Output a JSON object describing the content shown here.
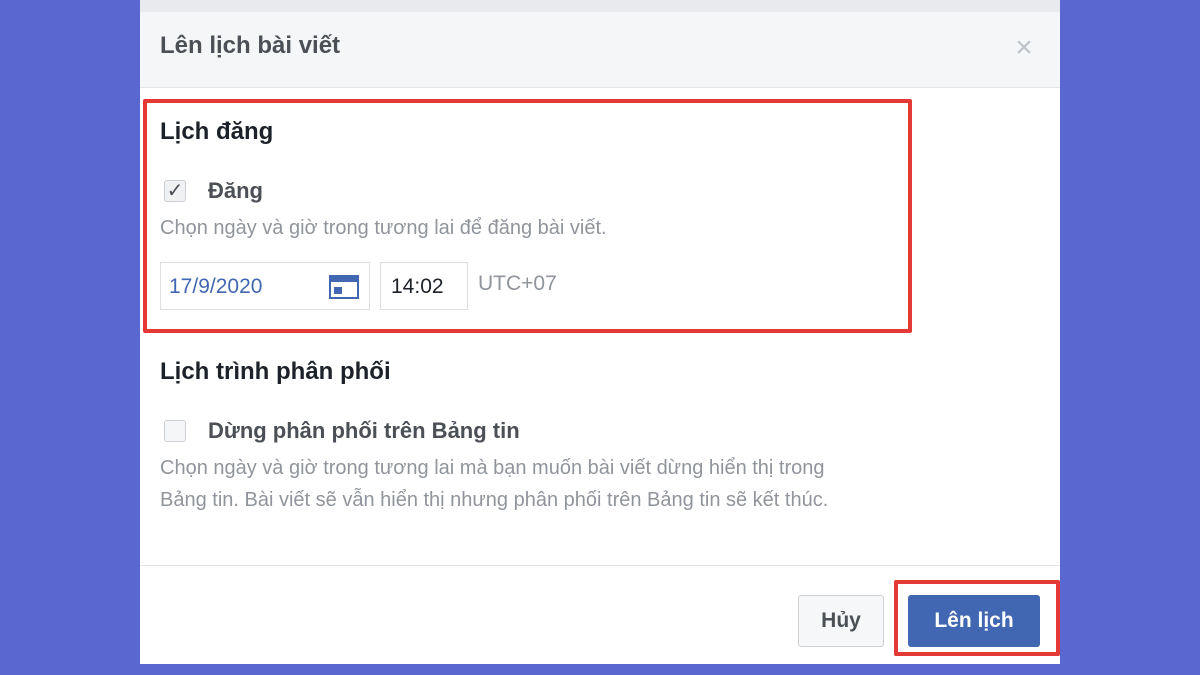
{
  "dialog": {
    "title": "Lên lịch bài viết",
    "close_icon": "close-icon"
  },
  "schedule_section": {
    "title": "Lịch đăng",
    "checkbox_label": "Đăng",
    "checked": true,
    "description": "Chọn ngày và giờ trong tương lai để đăng bài viết.",
    "date_value": "17/9/2020",
    "time_value": "14:02",
    "timezone": "UTC+07"
  },
  "distribution_section": {
    "title": "Lịch trình phân phối",
    "checkbox_label": "Dừng phân phối trên Bảng tin",
    "checked": false,
    "description_line1": "Chọn ngày và giờ trong tương lai mà bạn muốn bài viết dừng hiển thị trong",
    "description_line2": "Bảng tin. Bài viết sẽ vẫn hiển thị nhưng phân phối trên Bảng tin sẽ kết thúc."
  },
  "footer": {
    "cancel_label": "Hủy",
    "schedule_label": "Lên lịch"
  },
  "colors": {
    "background": "#5a67d0",
    "primary": "#4267b2",
    "highlight": "#e53935"
  }
}
